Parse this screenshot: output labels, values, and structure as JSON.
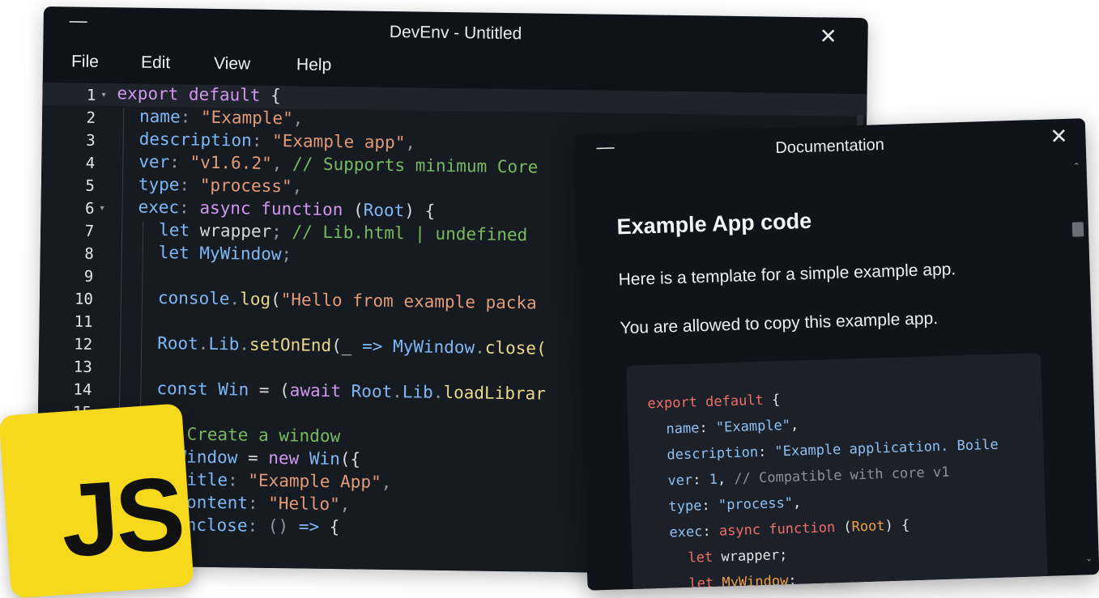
{
  "editor": {
    "title": "DevEnv - Untitled",
    "minimize_glyph": "—",
    "close_glyph": "✕",
    "menu": [
      "File",
      "Edit",
      "View",
      "Help"
    ],
    "line_numbers": [
      "1",
      "2",
      "3",
      "4",
      "5",
      "6",
      "7",
      "8",
      "9",
      "10",
      "11",
      "12",
      "13",
      "14",
      "15"
    ],
    "fold_marker": "▾",
    "code": {
      "l1_a": "export default",
      "l1_b": " {",
      "l2_a": "name",
      "l2_b": ": ",
      "l2_c": "\"Example\"",
      "l2_d": ",",
      "l3_a": "description",
      "l3_b": ": ",
      "l3_c": "\"Example app\"",
      "l3_d": ",",
      "l4_a": "ver",
      "l4_b": ": ",
      "l4_c": "\"v1.6.2\"",
      "l4_d": ", ",
      "l4_e": "// Supports minimum Core",
      "l5_a": "type",
      "l5_b": ": ",
      "l5_c": "\"process\"",
      "l5_d": ",",
      "l6_a": "exec",
      "l6_b": ": ",
      "l6_c": "async function",
      "l6_d": " (",
      "l6_e": "Root",
      "l6_f": ") {",
      "l7_a": "let",
      "l7_b": " wrapper",
      "l7_c": "; ",
      "l7_d": "// Lib.html | undefined",
      "l8_a": "let",
      "l8_b": " MyWindow",
      "l8_c": ";",
      "l10_a": "console",
      "l10_b": ".",
      "l10_c": "log",
      "l10_d": "(",
      "l10_e": "\"Hello from example packa",
      "l12_a": "Root",
      "l12_b": ".",
      "l12_c": "Lib",
      "l12_d": ".",
      "l12_e": "setOnEnd",
      "l12_f": "(_ ",
      "l12_g": "=>",
      "l12_h": " MyWindow",
      "l12_i": ".",
      "l12_j": "close(",
      "l14_a": "const",
      "l14_b": " Win",
      "l14_c": " = (",
      "l14_d": "await",
      "l14_e": " Root",
      "l14_f": ".",
      "l14_g": "Lib",
      "l14_h": ".",
      "l14_i": "loadLibrar",
      "l16_a": "// Create a window",
      "l17_a": "MyWindow",
      "l17_b": " = ",
      "l17_c": "new",
      "l17_d": " Win",
      "l17_e": "({",
      "l18_a": "title",
      "l18_b": ": ",
      "l18_c": "\"Example App\"",
      "l18_d": ",",
      "l19_a": "content",
      "l19_b": ": ",
      "l19_c": "\"Hello\"",
      "l19_d": ",",
      "l20_a": "onclose",
      "l20_b": ": () ",
      "l20_c": "=>",
      "l20_d": " {"
    }
  },
  "documentation": {
    "title": "Documentation",
    "minimize_glyph": "—",
    "close_glyph": "✕",
    "heading": "Example App code",
    "paragraph1": "Here is a template for a simple example app.",
    "paragraph2": "You are allowed to copy this example app.",
    "code": {
      "d1_a": "export default",
      "d1_b": " {",
      "d2_a": "name",
      "d2_b": ": ",
      "d2_c": "\"Example\"",
      "d2_d": ",",
      "d3_a": "description",
      "d3_b": ": ",
      "d3_c": "\"Example application. Boile",
      "d4_a": "ver",
      "d4_b": ": ",
      "d4_c": "1",
      "d4_d": ", ",
      "d4_e": "// Compatible with core v1",
      "d5_a": "type",
      "d5_b": ": ",
      "d5_c": "\"process\"",
      "d5_d": ",",
      "d6_a": "exec",
      "d6_b": ": ",
      "d6_c": "async function",
      "d6_d": " (",
      "d6_e": "Root",
      "d6_f": ") {",
      "d7_a": "let",
      "d7_b": " wrapper;",
      "d8_a": "let",
      "d8_b": " MyWindow",
      "d8_c": ";"
    },
    "scroll_up_glyph": "⌃",
    "scroll_down_glyph": "⌄"
  },
  "logo": {
    "text": "JS",
    "color": "#f6d91d"
  },
  "colors": {
    "keyword": "#d397f0",
    "property": "#7fb8f5",
    "string": "#e39b77",
    "comment": "#79ba61"
  }
}
